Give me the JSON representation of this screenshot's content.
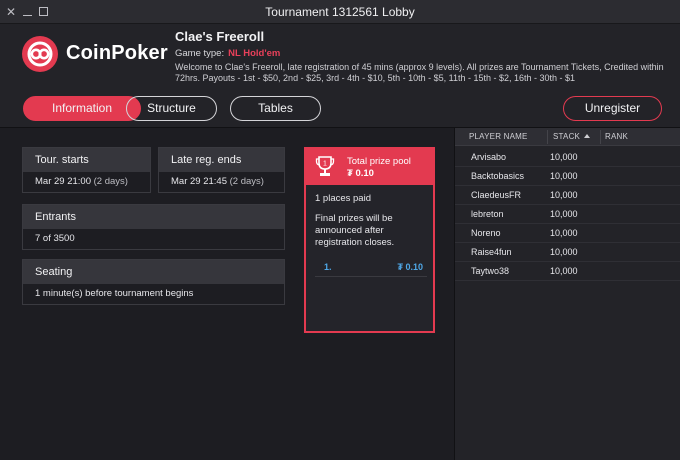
{
  "window": {
    "title": "Tournament 1312561 Lobby",
    "close_glyph": "✕",
    "min_icon": "minimize-icon",
    "max_icon": "maximize-icon"
  },
  "header": {
    "logo_text": "CoinPoker",
    "tournament_name": "Clae's Freeroll",
    "game_type_label": "Game type:",
    "game_type_value": "NL Hold'em",
    "description": "Welcome to Clae's Freeroll, late registration of 45 mins (approx 9 levels). All prizes are Tournament Tickets, Credited within 72hrs. Payouts - 1st - $50, 2nd - $25, 3rd - 4th - $10, 5th - 10th - $5, 11th - 15th - $2, 16th - 30th - $1"
  },
  "tabs": [
    {
      "label": "Information",
      "active": true
    },
    {
      "label": "Structure",
      "active": false
    },
    {
      "label": "Tables",
      "active": false
    }
  ],
  "unregister_label": "Unregister",
  "info": {
    "tour_starts": {
      "label": "Tour. starts",
      "date": "Mar 29 21:00",
      "note": "(2 days)"
    },
    "late_reg": {
      "label": "Late reg. ends",
      "date": "Mar 29 21:45",
      "note": "(2 days)"
    },
    "entrants": {
      "label": "Entrants",
      "value": "7 of 3500"
    },
    "seating": {
      "label": "Seating",
      "value": "1 minute(s) before tournament begins"
    }
  },
  "prize_pool": {
    "title": "Total prize pool",
    "value": "₮ 0.10",
    "places_paid": "1 places paid",
    "final_note": "Final prizes will be announced after registration closes.",
    "rows": [
      {
        "rank": "1.",
        "amount": "₮ 0.10"
      }
    ]
  },
  "players": {
    "columns": {
      "name": "PLAYER NAME",
      "stack": "STACK",
      "rank": "RANK"
    },
    "sort_icon": "sort-ascending-icon",
    "rows": [
      {
        "name": "Arvisabo",
        "stack": "10,000"
      },
      {
        "name": "Backtobasics",
        "stack": "10,000"
      },
      {
        "name": "ClaedeusFR",
        "stack": "10,000"
      },
      {
        "name": "lebreton",
        "stack": "10,000"
      },
      {
        "name": "Noreno",
        "stack": "10,000"
      },
      {
        "name": "Raise4fun",
        "stack": "10,000"
      },
      {
        "name": "Taytwo38",
        "stack": "10,000"
      }
    ]
  },
  "colors": {
    "accent": "#e33a50",
    "link_blue": "#4fa8e8",
    "background": "#1d1d22"
  }
}
